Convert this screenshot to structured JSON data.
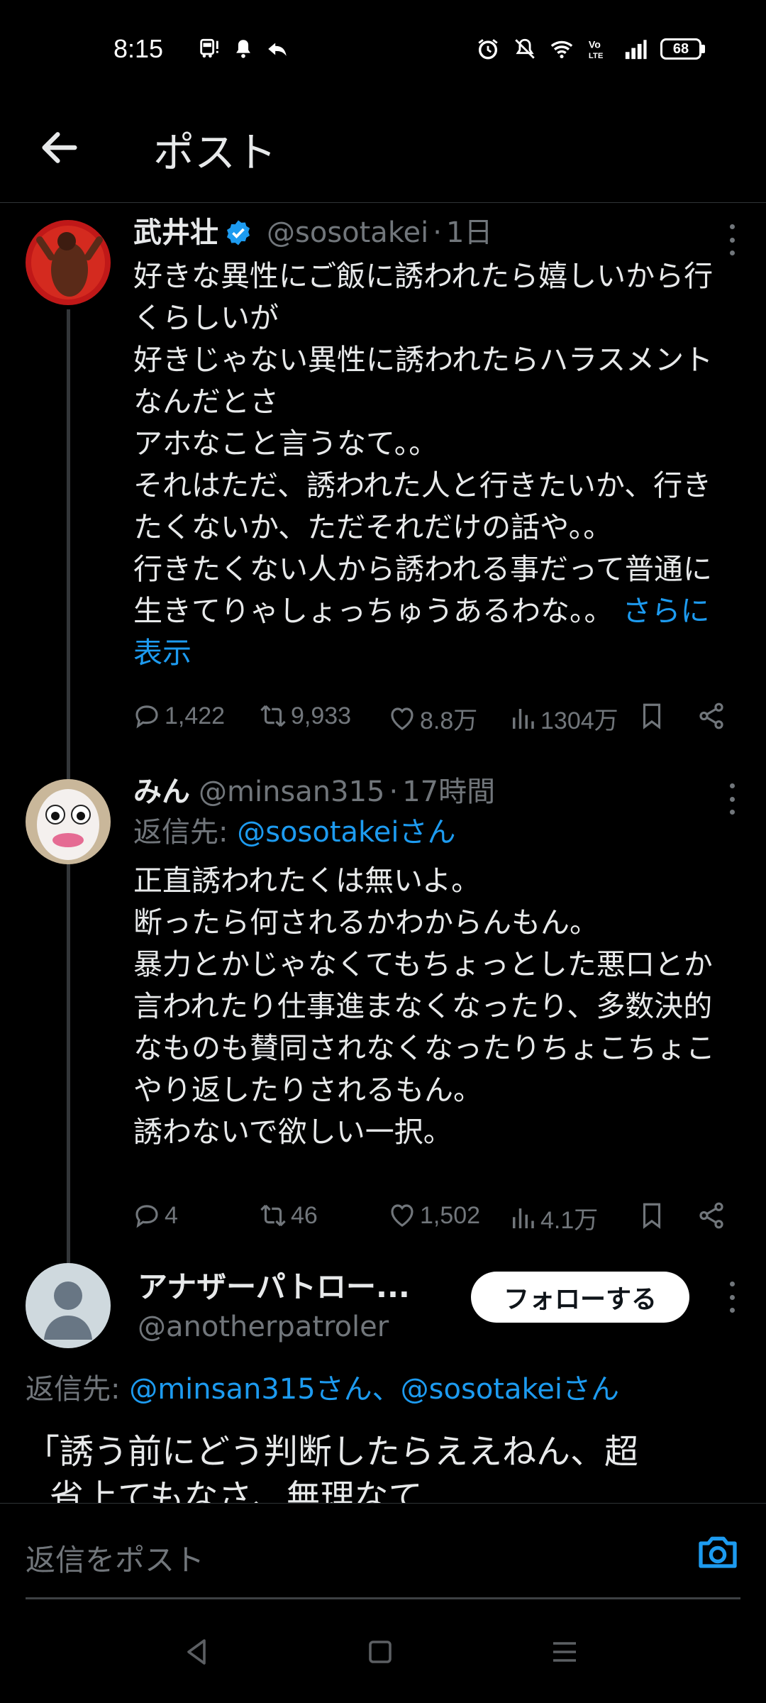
{
  "status_bar": {
    "time": "8:15",
    "battery": "68",
    "left_icons": [
      "bus-icon",
      "notification-icon",
      "reply-icon"
    ],
    "right_icons": [
      "alarm-icon",
      "vibrate-icon",
      "wifi-icon",
      "volte-icon",
      "signal-icon"
    ]
  },
  "header": {
    "title": "ポスト"
  },
  "tweets": [
    {
      "name": "武井壮",
      "verified": true,
      "handle": "@sosotakei",
      "separator": "·",
      "time": "1日",
      "text": "好きな異性にご飯に誘われたら嬉しいから行くらしいが\n好きじゃない異性に誘われたらハラスメントなんだとさ\nアホなこと言うなて。。\nそれはただ、誘われた人と行きたいか、行きたくないか、ただそれだけの話や。。\n行きたくない人から誘われる事だって普通に生きてりゃしょっちゅうあるわな。。 ",
      "show_more": "さらに表示",
      "replies": "1,422",
      "retweets": "9,933",
      "likes": "8.8万",
      "views": "1304万"
    },
    {
      "name": "みん",
      "handle": "@minsan315",
      "separator": "·",
      "time": "17時間",
      "reply_prefix": "返信先: ",
      "reply_target": "@sosotakeiさん",
      "text": "正直誘われたくは無いよ。\n断ったら何されるかわからんもん。\n暴力とかじゃなくてもちょっとした悪口とか言われたり仕事進まなくなったり、多数決的なものも賛同されなくなったりちょこちょこやり返したりされるもん。\n誘わないで欲しい一択。",
      "replies": "4",
      "retweets": "46",
      "likes": "1,502",
      "views": "4.1万"
    },
    {
      "name": "アナザーパトロー...",
      "handle": "@anotherpatroler",
      "follow_label": "フォローする",
      "reply_prefix": "返信先: ",
      "reply_target": "@minsan315さん、@sosotakeiさん",
      "text": "「誘う前にどう判断したらええねん、超",
      "text_line2": "省上てもなさ、無理なて"
    }
  ],
  "composer": {
    "placeholder": "返信をポスト"
  },
  "nav": {
    "back": "back-triangle-icon",
    "home": "home-square-icon",
    "menu": "menu-lines-icon"
  },
  "colors": {
    "background": "#000000",
    "text": "#e7e9ea",
    "muted": "#71767b",
    "accent": "#1d9bf0"
  }
}
